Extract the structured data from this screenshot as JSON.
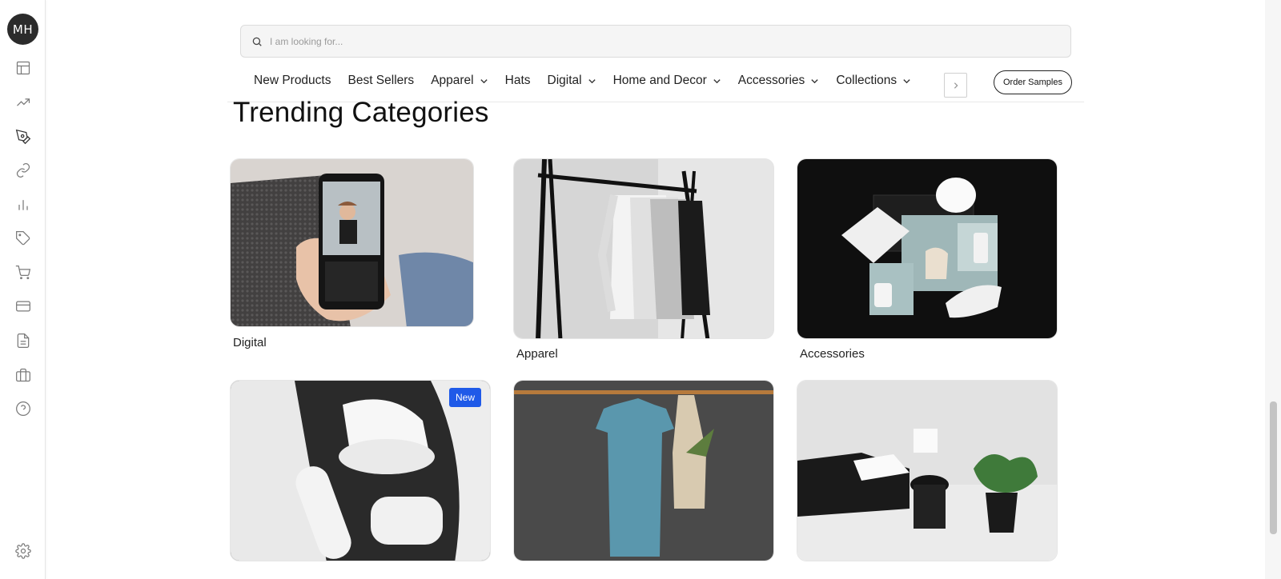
{
  "user": {
    "initials": "MH"
  },
  "sidebar": {
    "icons": [
      "layout-icon",
      "trending-icon",
      "pen-tool-icon",
      "link-icon",
      "bar-chart-icon",
      "tag-icon",
      "cart-icon",
      "credit-card-icon",
      "document-icon",
      "briefcase-icon",
      "help-icon",
      "settings-icon"
    ]
  },
  "search": {
    "placeholder": "I am looking for..."
  },
  "nav": {
    "items": [
      {
        "label": "New Products",
        "dropdown": false
      },
      {
        "label": "Best Sellers",
        "dropdown": false
      },
      {
        "label": "Apparel",
        "dropdown": true
      },
      {
        "label": "Hats",
        "dropdown": false
      },
      {
        "label": "Digital",
        "dropdown": true
      },
      {
        "label": "Home and Decor",
        "dropdown": true
      },
      {
        "label": "Accessories",
        "dropdown": true
      },
      {
        "label": "Collections",
        "dropdown": true
      }
    ],
    "order_samples": "Order Samples"
  },
  "section": {
    "title": "Trending Categories"
  },
  "categories": [
    {
      "label": "Digital",
      "badge": ""
    },
    {
      "label": "Apparel",
      "badge": ""
    },
    {
      "label": "Accessories",
      "badge": ""
    },
    {
      "label": "",
      "badge": "New"
    },
    {
      "label": "",
      "badge": ""
    },
    {
      "label": "",
      "badge": ""
    }
  ],
  "colors": {
    "accent_badge": "#1f5ae8",
    "avatar_bg": "#2b2b2b"
  }
}
